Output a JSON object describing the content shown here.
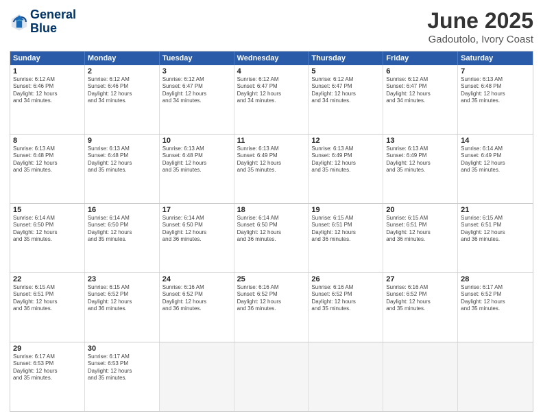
{
  "header": {
    "logo_line1": "General",
    "logo_line2": "Blue",
    "month": "June 2025",
    "location": "Gadoutolo, Ivory Coast"
  },
  "weekdays": [
    "Sunday",
    "Monday",
    "Tuesday",
    "Wednesday",
    "Thursday",
    "Friday",
    "Saturday"
  ],
  "rows": [
    [
      {
        "day": "1",
        "text": "Sunrise: 6:12 AM\nSunset: 6:46 PM\nDaylight: 12 hours\nand 34 minutes."
      },
      {
        "day": "2",
        "text": "Sunrise: 6:12 AM\nSunset: 6:46 PM\nDaylight: 12 hours\nand 34 minutes."
      },
      {
        "day": "3",
        "text": "Sunrise: 6:12 AM\nSunset: 6:47 PM\nDaylight: 12 hours\nand 34 minutes."
      },
      {
        "day": "4",
        "text": "Sunrise: 6:12 AM\nSunset: 6:47 PM\nDaylight: 12 hours\nand 34 minutes."
      },
      {
        "day": "5",
        "text": "Sunrise: 6:12 AM\nSunset: 6:47 PM\nDaylight: 12 hours\nand 34 minutes."
      },
      {
        "day": "6",
        "text": "Sunrise: 6:12 AM\nSunset: 6:47 PM\nDaylight: 12 hours\nand 34 minutes."
      },
      {
        "day": "7",
        "text": "Sunrise: 6:13 AM\nSunset: 6:48 PM\nDaylight: 12 hours\nand 35 minutes."
      }
    ],
    [
      {
        "day": "8",
        "text": "Sunrise: 6:13 AM\nSunset: 6:48 PM\nDaylight: 12 hours\nand 35 minutes."
      },
      {
        "day": "9",
        "text": "Sunrise: 6:13 AM\nSunset: 6:48 PM\nDaylight: 12 hours\nand 35 minutes."
      },
      {
        "day": "10",
        "text": "Sunrise: 6:13 AM\nSunset: 6:48 PM\nDaylight: 12 hours\nand 35 minutes."
      },
      {
        "day": "11",
        "text": "Sunrise: 6:13 AM\nSunset: 6:49 PM\nDaylight: 12 hours\nand 35 minutes."
      },
      {
        "day": "12",
        "text": "Sunrise: 6:13 AM\nSunset: 6:49 PM\nDaylight: 12 hours\nand 35 minutes."
      },
      {
        "day": "13",
        "text": "Sunrise: 6:13 AM\nSunset: 6:49 PM\nDaylight: 12 hours\nand 35 minutes."
      },
      {
        "day": "14",
        "text": "Sunrise: 6:14 AM\nSunset: 6:49 PM\nDaylight: 12 hours\nand 35 minutes."
      }
    ],
    [
      {
        "day": "15",
        "text": "Sunrise: 6:14 AM\nSunset: 6:50 PM\nDaylight: 12 hours\nand 35 minutes."
      },
      {
        "day": "16",
        "text": "Sunrise: 6:14 AM\nSunset: 6:50 PM\nDaylight: 12 hours\nand 35 minutes."
      },
      {
        "day": "17",
        "text": "Sunrise: 6:14 AM\nSunset: 6:50 PM\nDaylight: 12 hours\nand 36 minutes."
      },
      {
        "day": "18",
        "text": "Sunrise: 6:14 AM\nSunset: 6:50 PM\nDaylight: 12 hours\nand 36 minutes."
      },
      {
        "day": "19",
        "text": "Sunrise: 6:15 AM\nSunset: 6:51 PM\nDaylight: 12 hours\nand 36 minutes."
      },
      {
        "day": "20",
        "text": "Sunrise: 6:15 AM\nSunset: 6:51 PM\nDaylight: 12 hours\nand 36 minutes."
      },
      {
        "day": "21",
        "text": "Sunrise: 6:15 AM\nSunset: 6:51 PM\nDaylight: 12 hours\nand 36 minutes."
      }
    ],
    [
      {
        "day": "22",
        "text": "Sunrise: 6:15 AM\nSunset: 6:51 PM\nDaylight: 12 hours\nand 36 minutes."
      },
      {
        "day": "23",
        "text": "Sunrise: 6:15 AM\nSunset: 6:52 PM\nDaylight: 12 hours\nand 36 minutes."
      },
      {
        "day": "24",
        "text": "Sunrise: 6:16 AM\nSunset: 6:52 PM\nDaylight: 12 hours\nand 36 minutes."
      },
      {
        "day": "25",
        "text": "Sunrise: 6:16 AM\nSunset: 6:52 PM\nDaylight: 12 hours\nand 36 minutes."
      },
      {
        "day": "26",
        "text": "Sunrise: 6:16 AM\nSunset: 6:52 PM\nDaylight: 12 hours\nand 35 minutes."
      },
      {
        "day": "27",
        "text": "Sunrise: 6:16 AM\nSunset: 6:52 PM\nDaylight: 12 hours\nand 35 minutes."
      },
      {
        "day": "28",
        "text": "Sunrise: 6:17 AM\nSunset: 6:52 PM\nDaylight: 12 hours\nand 35 minutes."
      }
    ],
    [
      {
        "day": "29",
        "text": "Sunrise: 6:17 AM\nSunset: 6:53 PM\nDaylight: 12 hours\nand 35 minutes."
      },
      {
        "day": "30",
        "text": "Sunrise: 6:17 AM\nSunset: 6:53 PM\nDaylight: 12 hours\nand 35 minutes."
      },
      {
        "day": "",
        "text": ""
      },
      {
        "day": "",
        "text": ""
      },
      {
        "day": "",
        "text": ""
      },
      {
        "day": "",
        "text": ""
      },
      {
        "day": "",
        "text": ""
      }
    ]
  ]
}
